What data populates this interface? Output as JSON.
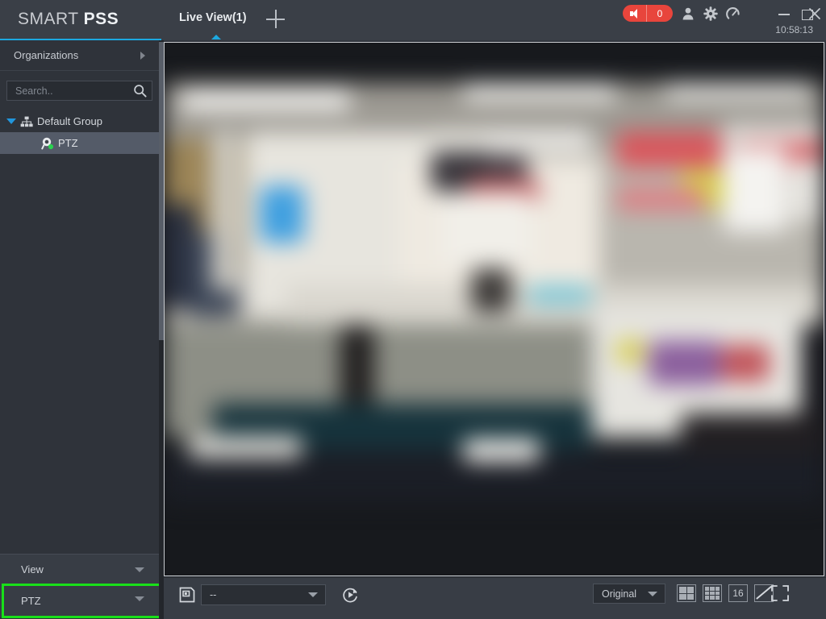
{
  "app": {
    "brand_light": "SMART ",
    "brand_bold": "PSS",
    "clock": "10:58:13"
  },
  "header": {
    "tabs": [
      {
        "label": "Live View(1)",
        "active": true
      }
    ],
    "add_tab_icon": "plus-icon",
    "alarm": {
      "icon": "speaker-icon",
      "count": "0",
      "color": "#e8453c"
    },
    "icons": [
      {
        "name": "user-icon"
      },
      {
        "name": "settings-gear-icon"
      },
      {
        "name": "performance-gauge-icon"
      }
    ],
    "window_controls": [
      {
        "name": "minimize-button"
      },
      {
        "name": "maximize-button"
      },
      {
        "name": "close-button"
      }
    ],
    "accent_color": "#1ca8e0"
  },
  "sidebar": {
    "organizations_label": "Organizations",
    "search": {
      "value": "",
      "placeholder": "Search..",
      "icon": "search-icon"
    },
    "tree": [
      {
        "label": "Default Group",
        "icon": "group-tree-icon",
        "expanded": true,
        "children": [
          {
            "label": "PTZ",
            "icon": "ptz-camera-icon",
            "status": "online",
            "selected": true
          }
        ]
      }
    ],
    "panels": [
      {
        "label": "View",
        "expanded": false
      },
      {
        "label": "PTZ",
        "expanded": false,
        "highlighted": true
      }
    ],
    "highlight_color": "#19e019"
  },
  "video": {
    "stream_label": "Live video stream",
    "panes": 1
  },
  "toolbar": {
    "save_icon": "save-snapshot-icon",
    "stream_select": {
      "value": "--",
      "placeholder": "--"
    },
    "tour_icon": "tour-play-icon",
    "ratio_select": {
      "value": "Original"
    },
    "layouts": [
      {
        "name": "layout-4-button",
        "label": ""
      },
      {
        "name": "layout-9-button",
        "label": ""
      },
      {
        "name": "layout-16-button",
        "label": "16"
      },
      {
        "name": "layout-custom-button",
        "label": ""
      }
    ],
    "fullscreen_icon": "fullscreen-icon"
  }
}
